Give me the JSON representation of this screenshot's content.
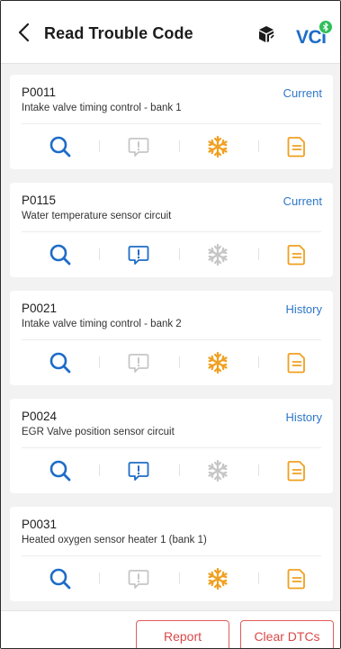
{
  "header": {
    "title": "Read Trouble Code",
    "vci_label": "VCI",
    "back_icon": "chevron-left-icon",
    "device_icon": "box-icon",
    "badge_icon": "bluetooth-icon"
  },
  "colors": {
    "accent_blue": "#1e6cc7",
    "status_blue": "#2e77c9",
    "freeze_active": "#f0a020",
    "inactive_gray": "#c6c6c6",
    "report_orange": "#f0a020",
    "button_red": "#d94848",
    "badge_green": "#2fbf5a"
  },
  "dtcs": [
    {
      "code": "P0011",
      "description": "Intake valve timing control - bank 1",
      "status": "Current",
      "info_active": false,
      "freeze_active": true
    },
    {
      "code": "P0115",
      "description": "Water temperature sensor circuit",
      "status": "Current",
      "info_active": true,
      "freeze_active": false
    },
    {
      "code": "P0021",
      "description": "Intake valve timing control - bank 2",
      "status": "History",
      "info_active": false,
      "freeze_active": true
    },
    {
      "code": "P0024",
      "description": "EGR Valve position sensor circuit",
      "status": "History",
      "info_active": true,
      "freeze_active": false
    },
    {
      "code": "P0031",
      "description": "Heated oxygen sensor heater 1 (bank 1)",
      "status": "",
      "info_active": false,
      "freeze_active": true
    }
  ],
  "action_icons": [
    "search-icon",
    "info-message-icon",
    "freeze-frame-icon",
    "report-document-icon"
  ],
  "footer": {
    "report_label": "Report",
    "clear_label": "Clear DTCs"
  }
}
